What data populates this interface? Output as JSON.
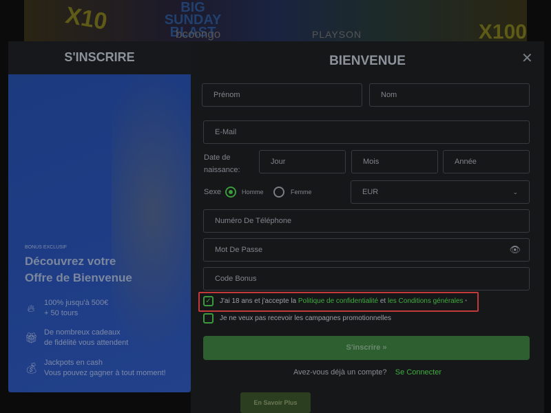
{
  "banner": {
    "title_lines": [
      "BIG",
      "SUNDAY",
      "BLAST"
    ],
    "multiplier_left": "X10",
    "multiplier_right": "X100",
    "provider_1": "bcoongo",
    "provider_2": "PLAYSON"
  },
  "left": {
    "tab": "S'INSCRIRE",
    "bonus_label": "BONUS EXCLUSIF",
    "headline_1": "Découvrez votre",
    "headline_2": "Offre de Bienvenue",
    "features": [
      {
        "icon": "fire-icon",
        "line1": "100% jusqu'à 500€",
        "line2": "+ 50 tours"
      },
      {
        "icon": "gift-icon",
        "line1": "De nombreux cadeaux",
        "line2": "de fidélité vous attendent"
      },
      {
        "icon": "money-bag-icon",
        "line1": "Jackpots en cash",
        "line2": "Vous pouvez gagner à tout moment!"
      }
    ]
  },
  "form": {
    "title": "BIENVENUE",
    "first_name": "Prénom",
    "last_name": "Nom",
    "email": "E-Mail",
    "dob_label_1": "Date de",
    "dob_label_2": "naissance:",
    "day": "Jour",
    "month": "Mois",
    "year": "Année",
    "sex_label": "Sexe",
    "male": "Homme",
    "female": "Femme",
    "sex_selected": "Homme",
    "currency": "EUR",
    "phone": "Numéro De Téléphone",
    "password": "Mot De Passe",
    "bonus_code": "Code Bonus",
    "terms_pre": "J'ai 18 ans et j'accepte la",
    "terms_privacy": "Politique de confidentialité",
    "terms_and": "et",
    "terms_conditions": "les Conditions générales",
    "terms_required": "*",
    "terms_checked": true,
    "promo_optout": "Je ne veux pas recevoir les campagnes promotionnelles",
    "promo_optout_checked": false,
    "submit": "S'inscrire",
    "has_account": "Avez-vous déjà un compte?",
    "login": "Se Connecter"
  },
  "behind": {
    "learn_more": "En Savoir Plus"
  },
  "colors": {
    "accent_green": "#3fae3f",
    "button_green": "#2d5f31",
    "highlight_red": "#c43a3a"
  }
}
